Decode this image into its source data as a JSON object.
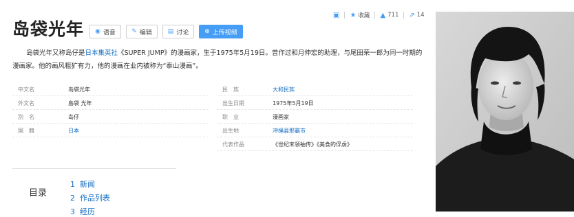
{
  "page": {
    "title": "岛袋光年"
  },
  "toolbar": {
    "favorite_label": "收藏",
    "like_count": "711",
    "share_count": "14"
  },
  "actions": {
    "voice": "语音",
    "edit": "编辑",
    "discuss": "讨论",
    "upload": "上传视频"
  },
  "intro": {
    "p1": "岛袋光年又称岛仔是",
    "link1": "日本集英社",
    "p2": "《SUPER JUMP》的漫画家，生于1975年5月19日。曾作过和月伸宏的助理，与尾田荣一郎为同一时期的漫画家。他的画风粗犷有力，他的漫画在业内被称为“泰山漫画”。"
  },
  "basic_info": {
    "left": [
      {
        "key": "中文名",
        "value": "岛袋光年"
      },
      {
        "key": "外文名",
        "value": "島袋 光年"
      },
      {
        "key": "别　名",
        "value": "岛仔"
      },
      {
        "key": "国　籍",
        "value": "日本"
      }
    ],
    "right": [
      {
        "key": "民　族",
        "value": "大和民族"
      },
      {
        "key": "出生日期",
        "value": "1975年5月19日"
      },
      {
        "key": "职　业",
        "value": "漫画家"
      },
      {
        "key": "出生地",
        "value": "冲绳县那霸市"
      },
      {
        "key": "代表作品",
        "value": "《世纪末领袖传》《美食的俘虏》"
      }
    ]
  },
  "toc": {
    "label": "目录",
    "items": [
      {
        "num": "1",
        "label": "新闻"
      },
      {
        "num": "2",
        "label": "作品列表"
      },
      {
        "num": "3",
        "label": "经历"
      }
    ]
  },
  "icons": {
    "comment": "comment-icon",
    "favorite": "star-icon",
    "like": "thumbs-up-icon",
    "share": "share-icon",
    "voice": "headphones-icon",
    "edit": "pencil-icon",
    "discuss": "chat-icon",
    "upload": "plus-circle-icon"
  },
  "colors": {
    "accent": "#459df5",
    "link": "#136ec2"
  }
}
